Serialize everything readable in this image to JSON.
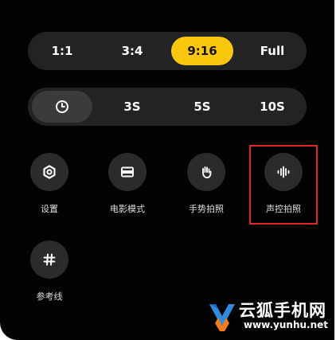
{
  "aspect_ratio": {
    "options": [
      "1:1",
      "3:4",
      "9:16",
      "Full"
    ],
    "selected": "9:16"
  },
  "timer": {
    "options": [
      "3S",
      "5S",
      "10S"
    ],
    "selected_icon": "clock-icon"
  },
  "tools": {
    "settings": {
      "label": "设置",
      "icon": "gear-icon"
    },
    "movie_mode": {
      "label": "电影模式",
      "icon": "widescreen-icon"
    },
    "gesture_shot": {
      "label": "手势拍照",
      "icon": "hand-icon"
    },
    "voice_shot": {
      "label": "声控拍照",
      "icon": "sound-wave-icon"
    },
    "grid_lines": {
      "label": "参考线",
      "icon": "grid-icon"
    }
  },
  "colors": {
    "panel": "#030303",
    "pill": "#232323",
    "accent": "#f9c80e",
    "highlight": "#e0262a"
  },
  "watermark": {
    "name": "云狐手机网",
    "url": "www.yunhu.net"
  }
}
